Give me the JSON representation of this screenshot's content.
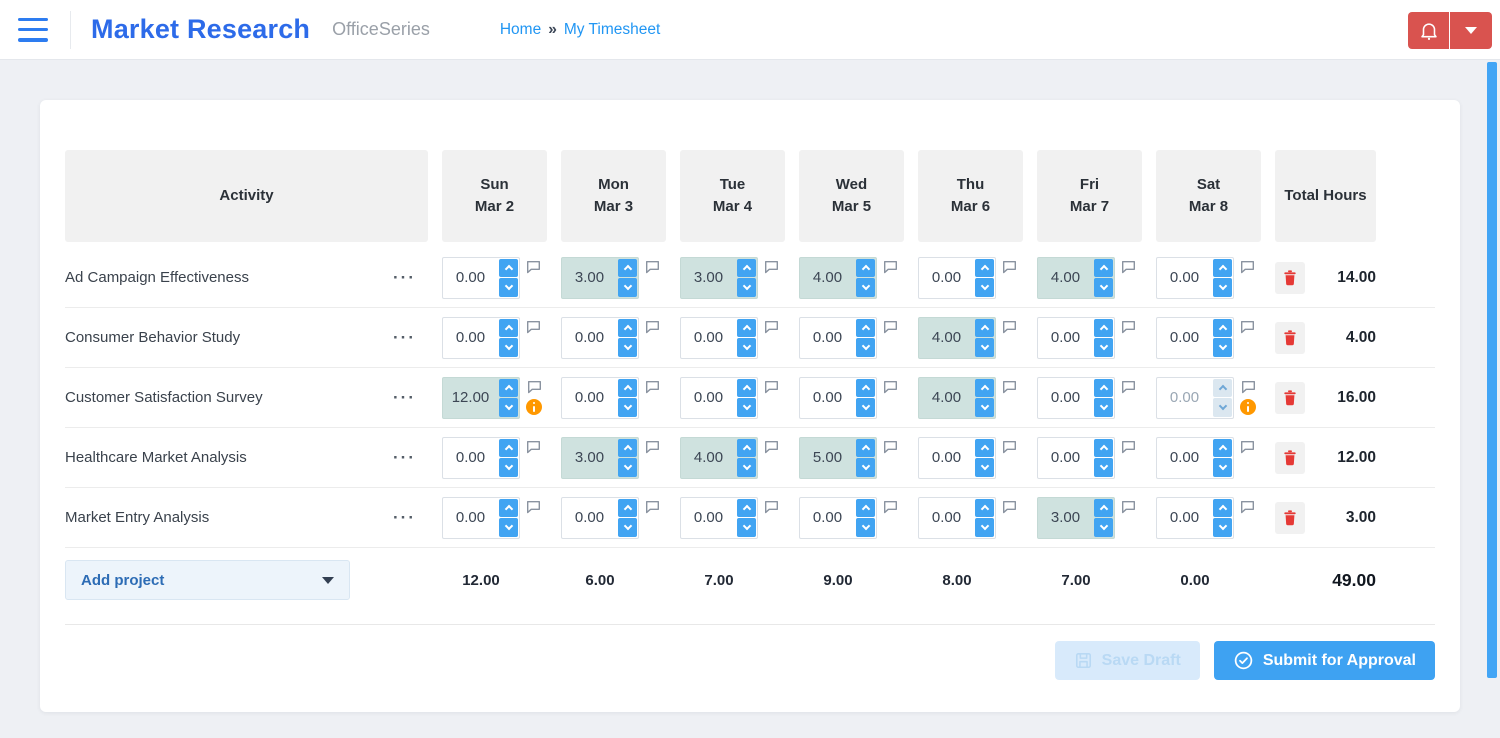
{
  "header": {
    "title": "Market Research",
    "suite": "OfficeSeries",
    "breadcrumb": {
      "home": "Home",
      "separator": "»",
      "current": "My Timesheet"
    }
  },
  "timesheet": {
    "activity_header": "Activity",
    "total_header": "Total Hours",
    "row_menu_glyph": "···",
    "days": [
      {
        "name": "Sun",
        "date": "Mar 2"
      },
      {
        "name": "Mon",
        "date": "Mar 3"
      },
      {
        "name": "Tue",
        "date": "Mar 4"
      },
      {
        "name": "Wed",
        "date": "Mar 5"
      },
      {
        "name": "Thu",
        "date": "Mar 6"
      },
      {
        "name": "Fri",
        "date": "Mar 7"
      },
      {
        "name": "Sat",
        "date": "Mar 8"
      }
    ],
    "rows": [
      {
        "activity": "Ad Campaign Effectiveness",
        "hours": [
          "0.00",
          "3.00",
          "3.00",
          "4.00",
          "0.00",
          "4.00",
          "0.00"
        ],
        "warnings": [],
        "disabled": [],
        "total": "14.00"
      },
      {
        "activity": "Consumer Behavior Study",
        "hours": [
          "0.00",
          "0.00",
          "0.00",
          "0.00",
          "4.00",
          "0.00",
          "0.00"
        ],
        "warnings": [],
        "disabled": [],
        "total": "4.00"
      },
      {
        "activity": "Customer Satisfaction Survey",
        "hours": [
          "12.00",
          "0.00",
          "0.00",
          "0.00",
          "4.00",
          "0.00",
          "0.00"
        ],
        "warnings": [
          0,
          6
        ],
        "disabled": [
          6
        ],
        "total": "16.00"
      },
      {
        "activity": "Healthcare Market Analysis",
        "hours": [
          "0.00",
          "3.00",
          "4.00",
          "5.00",
          "0.00",
          "0.00",
          "0.00"
        ],
        "warnings": [],
        "disabled": [],
        "total": "12.00"
      },
      {
        "activity": "Market Entry Analysis",
        "hours": [
          "0.00",
          "0.00",
          "0.00",
          "0.00",
          "0.00",
          "3.00",
          "0.00"
        ],
        "warnings": [],
        "disabled": [],
        "total": "3.00"
      }
    ],
    "day_totals": [
      "12.00",
      "6.00",
      "7.00",
      "9.00",
      "8.00",
      "7.00",
      "0.00"
    ],
    "grand_total": "49.00",
    "add_project_label": "Add project"
  },
  "actions": {
    "save_draft": "Save Draft",
    "submit": "Submit for Approval"
  },
  "colors": {
    "accent_blue": "#2d6be9",
    "link_blue": "#2196f3",
    "spinner_blue": "#41a4f2",
    "filled_cell_teal": "#cfe2df",
    "notification_red": "#d9534f",
    "trash_red": "#e53935",
    "warning_orange": "#ff9800",
    "scrollbar_blue": "#42a5f5"
  }
}
